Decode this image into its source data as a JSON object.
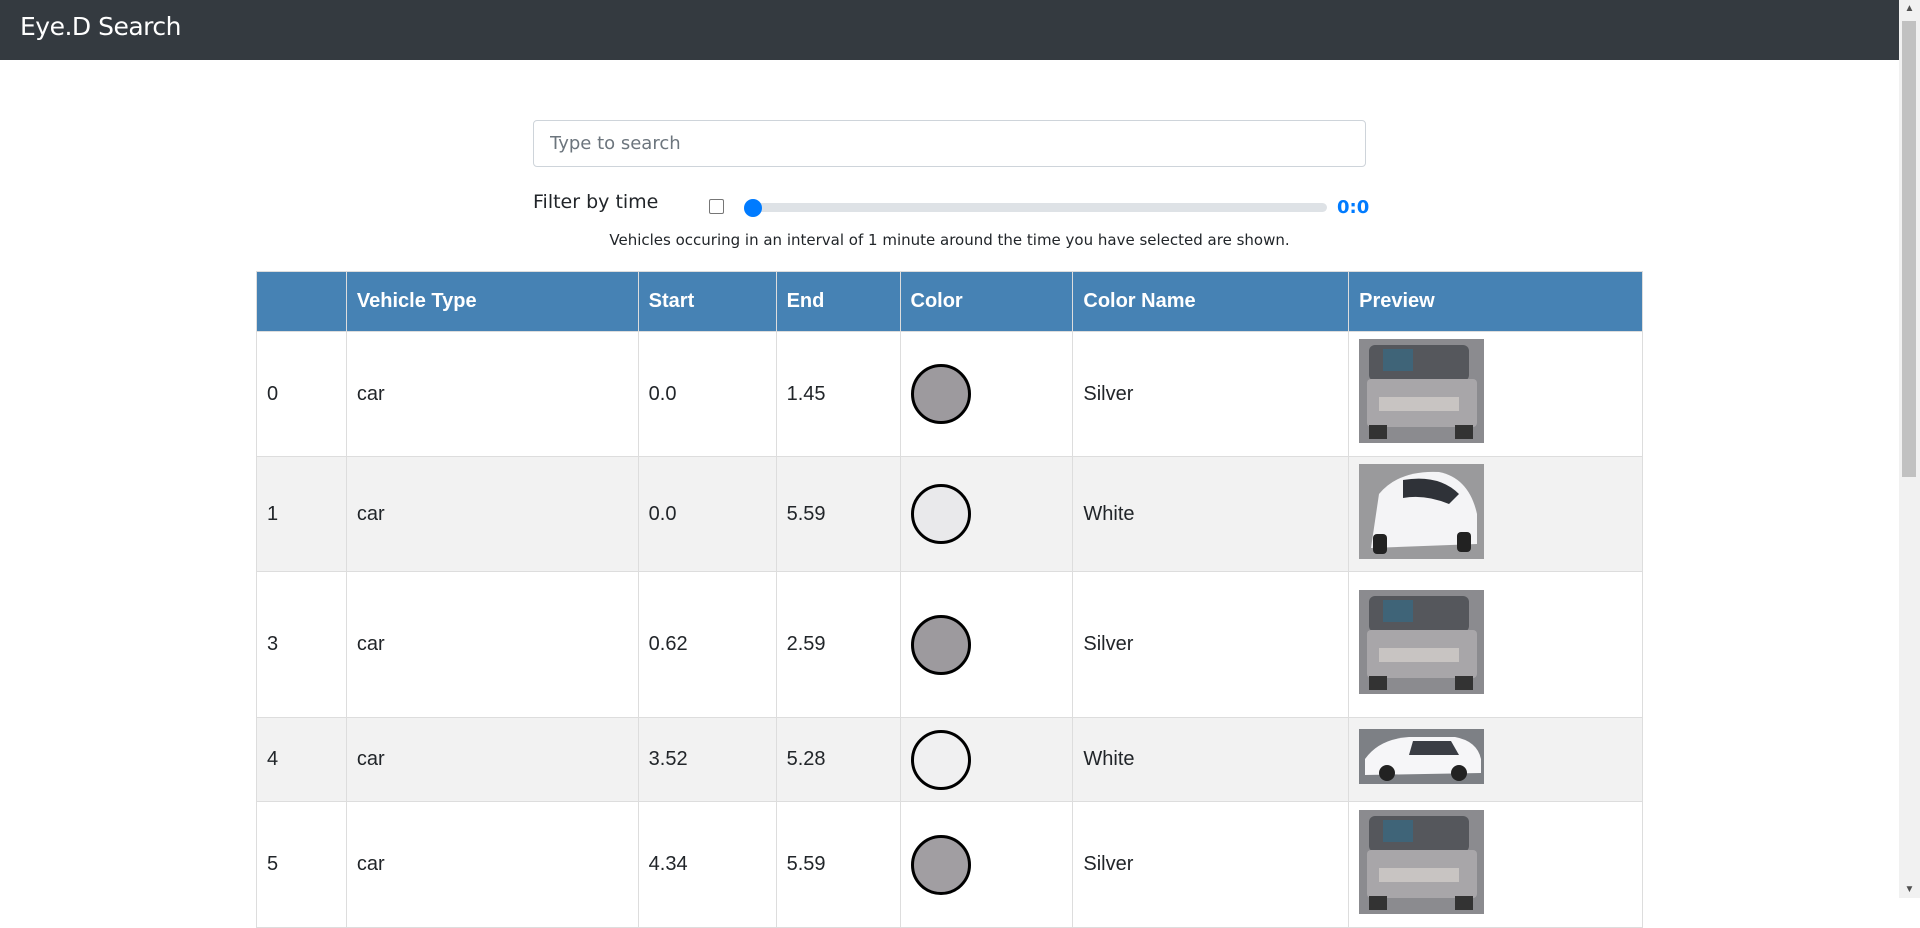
{
  "navbar": {
    "brand": "Eye.D Search"
  },
  "search": {
    "placeholder": "Type to search",
    "value": ""
  },
  "filter": {
    "label": "Filter by time",
    "checked": false,
    "slider_fraction": 0,
    "value_text": "0:0",
    "hint": "Vehicles occuring in an interval of 1 minute around the time you have selected are shown."
  },
  "table": {
    "headers": [
      "",
      "Vehicle Type",
      "Start",
      "End",
      "Color",
      "Color Name",
      "Preview"
    ],
    "rows": [
      {
        "id": "0",
        "type": "car",
        "start": "0.0",
        "end": "1.45",
        "color": "#9d9a9e",
        "color_name": "Silver",
        "preview": "silver-pickup"
      },
      {
        "id": "1",
        "type": "car",
        "start": "0.0",
        "end": "5.59",
        "color": "#e9e9eb",
        "color_name": "White",
        "preview": "white-sedan"
      },
      {
        "id": "3",
        "type": "car",
        "start": "0.62",
        "end": "2.59",
        "color": "#9d9a9e",
        "color_name": "Silver",
        "preview": "silver-pickup"
      },
      {
        "id": "4",
        "type": "car",
        "start": "3.52",
        "end": "5.28",
        "color": "#f0f0f1",
        "color_name": "White",
        "preview": "white-suv"
      },
      {
        "id": "5",
        "type": "car",
        "start": "4.34",
        "end": "5.59",
        "color": "#a19ea2",
        "color_name": "Silver",
        "preview": "silver-pickup"
      }
    ]
  }
}
